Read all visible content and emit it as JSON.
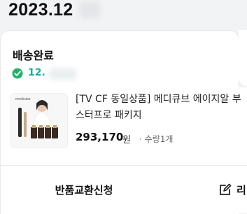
{
  "header": {
    "date": "2023.12"
  },
  "order": {
    "status": "배송완료",
    "tracking_visible": "12.",
    "product": {
      "title": "[TV CF 동일상품] 메디큐브 에이지알 부스터 프로 패키지",
      "title_visible": "[TV CF 동일상품] 메디큐브 에이지알 부스터프로 패키지",
      "thumb_brand": "medicube",
      "price": "293,170",
      "price_unit": "원",
      "quantity": "· 수량1개"
    },
    "actions": {
      "exchange_label": "반품교환신청",
      "review_label": "리"
    }
  },
  "colors": {
    "accent_green": "#1da8a0",
    "check_green": "#1fb46a",
    "background": "#f2f3f5"
  },
  "icons": [
    "check-circle-icon",
    "edit-icon"
  ]
}
